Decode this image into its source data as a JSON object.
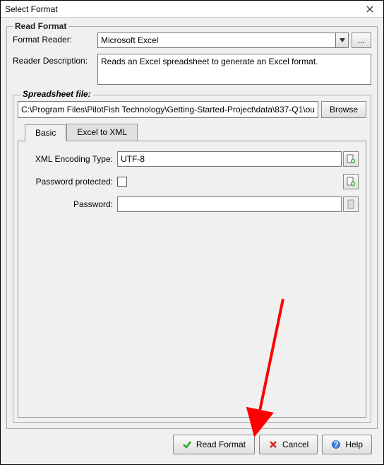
{
  "window": {
    "title": "Select Format"
  },
  "readFormat": {
    "legend": "Read Format",
    "formatReaderLabel": "Format Reader:",
    "formatReaderValue": "Microsoft Excel",
    "browseDots": "...",
    "readerDescLabel": "Reader Description:",
    "readerDescValue": "Reads an Excel spreadsheet to generate an Excel format."
  },
  "spreadsheet": {
    "legend": "Spreadsheet file:",
    "path": "C:\\Program Files\\PilotFish Technology\\Getting-Started-Project\\data\\837-Q1\\ou",
    "browse": "Browse"
  },
  "tabs": {
    "basic": "Basic",
    "excelToXml": "Excel to XML"
  },
  "basic": {
    "xmlEncodingLabel": "XML Encoding Type:",
    "xmlEncodingValue": "UTF-8",
    "passwordProtectedLabel": "Password protected:",
    "passwordLabel": "Password:",
    "passwordValue": ""
  },
  "buttons": {
    "readFormat": "Read Format",
    "cancel": "Cancel",
    "help": "Help"
  }
}
